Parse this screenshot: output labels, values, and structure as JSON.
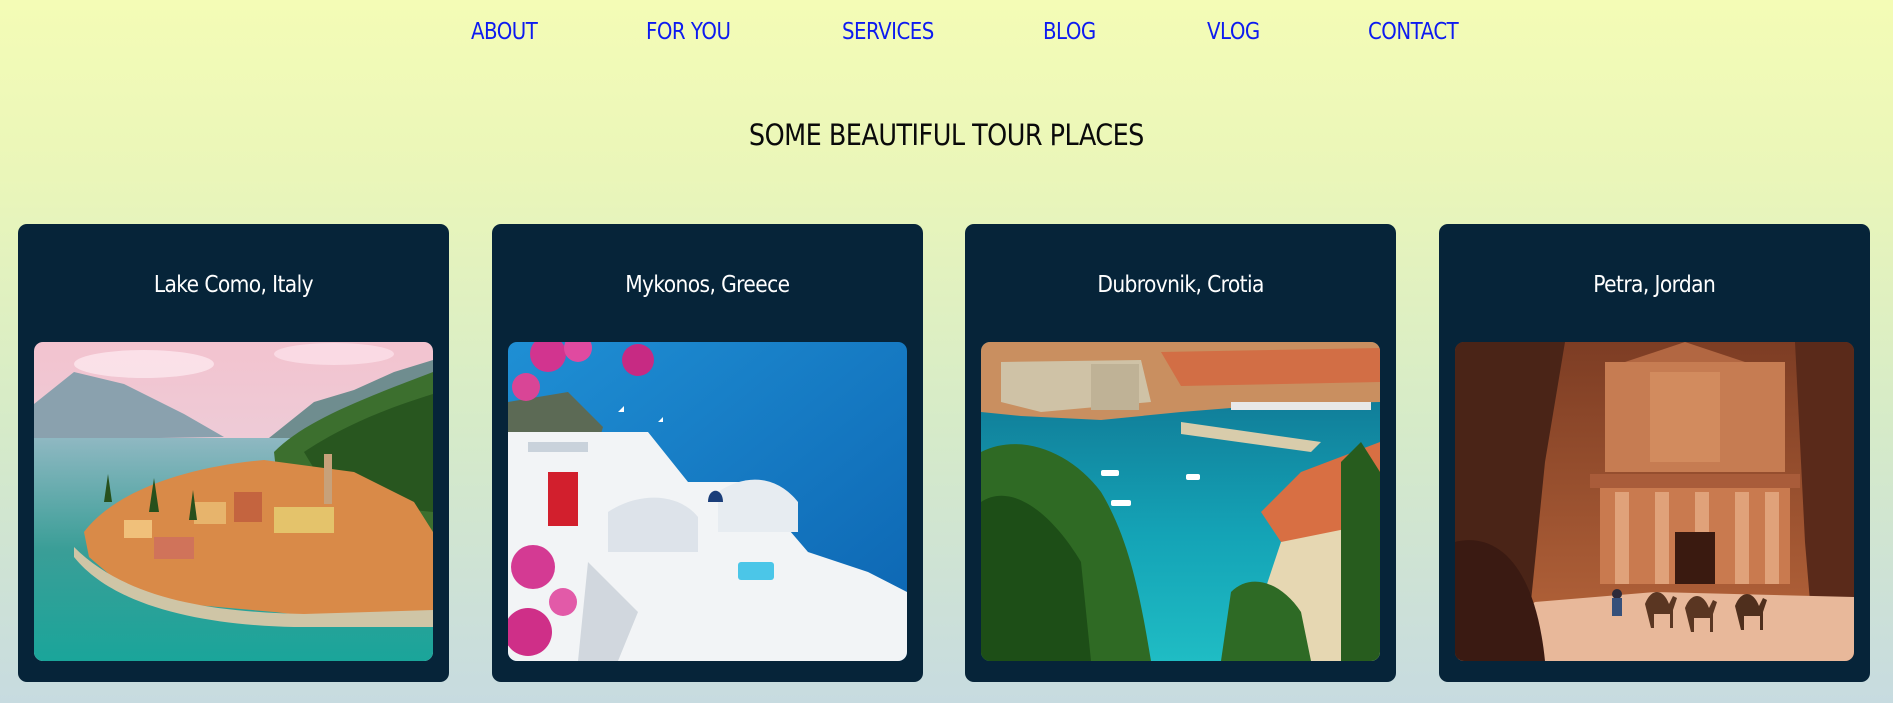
{
  "nav": {
    "items": [
      {
        "label": "ABOUT"
      },
      {
        "label": "FOR YOU"
      },
      {
        "label": "SERVICES"
      },
      {
        "label": "BLOG"
      },
      {
        "label": "VLOG"
      },
      {
        "label": "CONTACT"
      }
    ]
  },
  "page": {
    "title": "SOME BEAUTIFUL TOUR PLACES"
  },
  "places": [
    {
      "name": "Lake Como, Italy"
    },
    {
      "name": "Mykonos, Greece"
    },
    {
      "name": "Dubrovnik, Crotia"
    },
    {
      "name": "Petra, Jordan"
    }
  ],
  "colors": {
    "nav_link": "#0d1bf0",
    "card_background": "#062439",
    "card_title": "#ffffff",
    "background_top": "#f4fcb6",
    "background_bottom": "#c7dbe0"
  }
}
